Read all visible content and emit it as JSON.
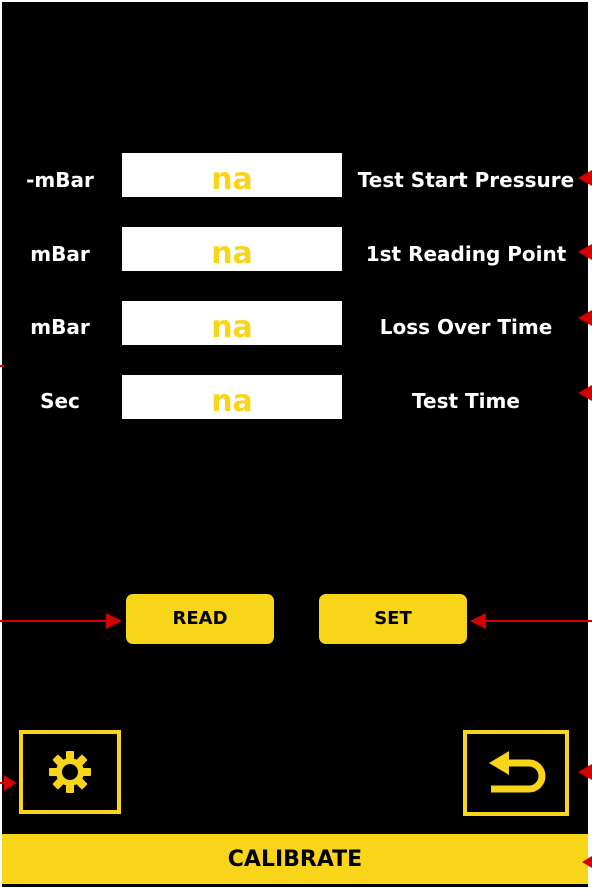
{
  "colors": {
    "background": "#000000",
    "accent": "#F9D51A",
    "field_background": "#FFFFFF",
    "text": "#FFFFFF",
    "annotation_arrow": "#D40000"
  },
  "parameters": [
    {
      "unit": "-mBar",
      "value": "na",
      "label": "Test Start Pressure"
    },
    {
      "unit": "mBar",
      "value": "na",
      "label": "1st Reading Point"
    },
    {
      "unit": "mBar",
      "value": "na",
      "label": "Loss Over Time"
    },
    {
      "unit": "Sec",
      "value": "na",
      "label": "Test Time"
    }
  ],
  "buttons": {
    "read_label": "READ",
    "set_label": "SET",
    "calibrate_label": "CALIBRATE"
  },
  "icons": {
    "settings": "gear-icon",
    "back": "return-arrow-icon"
  }
}
